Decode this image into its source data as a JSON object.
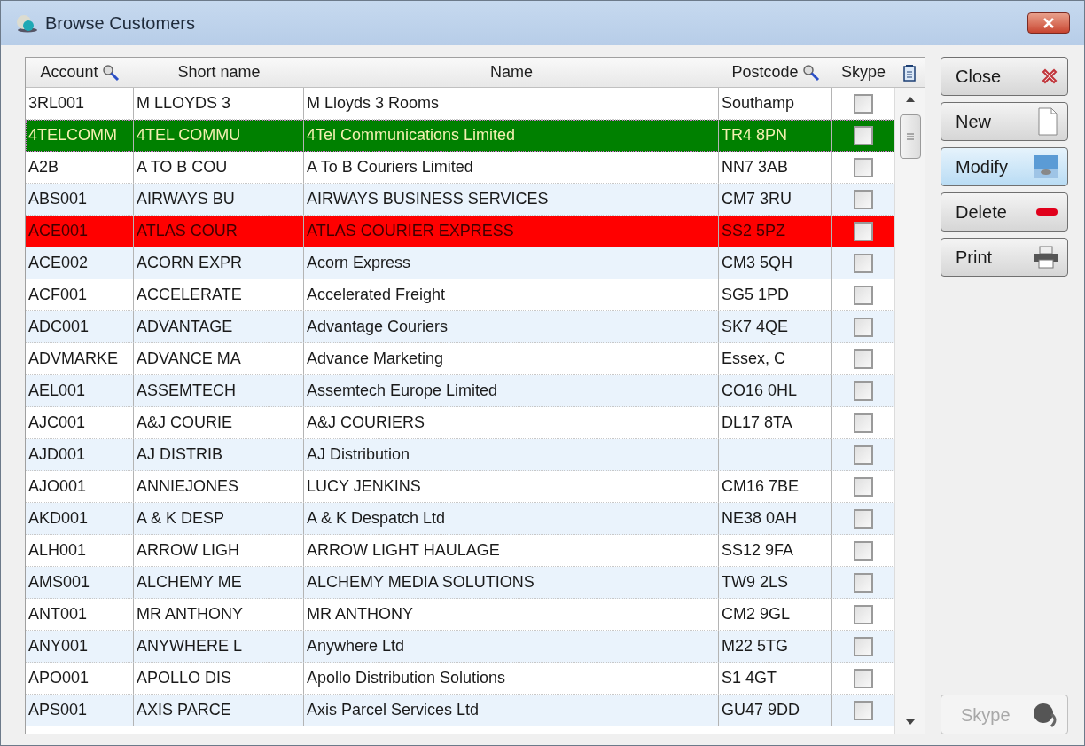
{
  "window": {
    "title": "Browse Customers"
  },
  "table": {
    "columns": [
      {
        "label": "Account",
        "searchable": true
      },
      {
        "label": "Short name",
        "searchable": false
      },
      {
        "label": "Name",
        "searchable": false
      },
      {
        "label": "Postcode",
        "searchable": true
      },
      {
        "label": "Skype",
        "searchable": false
      }
    ],
    "rows": [
      {
        "account": "3RL001",
        "short_name": "M LLOYDS 3",
        "name": "M Lloyds 3 Rooms",
        "postcode": "Southamp",
        "skype": false,
        "selected": false,
        "kind": "normal"
      },
      {
        "account": "4TELCOMM",
        "short_name": "4TEL COMMU",
        "name": "4Tel Communications Limited",
        "postcode": "TR4 8PN",
        "skype": false,
        "selected": true,
        "kind": "normal"
      },
      {
        "account": "A2B",
        "short_name": "A TO B COU",
        "name": "A To B Couriers Limited",
        "postcode": "NN7 3AB",
        "skype": false,
        "selected": false,
        "kind": "normal"
      },
      {
        "account": "ABS001",
        "short_name": "AIRWAYS BU",
        "name": "AIRWAYS BUSINESS SERVICES",
        "postcode": "CM7 3RU",
        "skype": false,
        "selected": false,
        "kind": "normal"
      },
      {
        "account": "ACE001",
        "short_name": "ATLAS COUR",
        "name": "ATLAS COURIER EXPRESS",
        "postcode": "SS2 5PZ",
        "skype": false,
        "selected": false,
        "kind": "alert"
      },
      {
        "account": "ACE002",
        "short_name": "ACORN EXPR",
        "name": "Acorn Express",
        "postcode": "CM3 5QH",
        "skype": false,
        "selected": false,
        "kind": "normal"
      },
      {
        "account": "ACF001",
        "short_name": "ACCELERATE",
        "name": "Accelerated Freight",
        "postcode": "SG5 1PD",
        "skype": false,
        "selected": false,
        "kind": "normal"
      },
      {
        "account": "ADC001",
        "short_name": "ADVANTAGE",
        "name": "Advantage Couriers",
        "postcode": "SK7 4QE",
        "skype": false,
        "selected": false,
        "kind": "normal"
      },
      {
        "account": "ADVMARKE",
        "short_name": "ADVANCE MA",
        "name": "Advance Marketing",
        "postcode": "Essex, C",
        "skype": false,
        "selected": false,
        "kind": "normal"
      },
      {
        "account": "AEL001",
        "short_name": "ASSEMTECH",
        "name": "Assemtech Europe Limited",
        "postcode": "CO16 0HL",
        "skype": false,
        "selected": false,
        "kind": "normal"
      },
      {
        "account": "AJC001",
        "short_name": "A&J COURIE",
        "name": "A&J COURIERS",
        "postcode": "DL17 8TA",
        "skype": false,
        "selected": false,
        "kind": "normal"
      },
      {
        "account": "AJD001",
        "short_name": "AJ DISTRIB",
        "name": "AJ Distribution",
        "skype": false,
        "selected": false,
        "kind": "normal"
      },
      {
        "account": "AJO001",
        "short_name": "ANNIEJONES",
        "name": "LUCY JENKINS",
        "postcode": "CM16 7BE",
        "skype": false,
        "selected": false,
        "kind": "normal"
      },
      {
        "account": "AKD001",
        "short_name": "A & K DESP",
        "name": "A & K Despatch Ltd",
        "postcode": "NE38 0AH",
        "skype": false,
        "selected": false,
        "kind": "normal"
      },
      {
        "account": "ALH001",
        "short_name": "ARROW LIGH",
        "name": "ARROW LIGHT HAULAGE",
        "postcode": "SS12 9FA",
        "skype": false,
        "selected": false,
        "kind": "normal"
      },
      {
        "account": "AMS001",
        "short_name": "ALCHEMY ME",
        "name": "ALCHEMY MEDIA SOLUTIONS",
        "postcode": "TW9 2LS",
        "skype": false,
        "selected": false,
        "kind": "normal"
      },
      {
        "account": "ANT001",
        "short_name": "MR ANTHONY",
        "name": "MR ANTHONY",
        "postcode": "CM2 9GL",
        "skype": false,
        "selected": false,
        "kind": "normal"
      },
      {
        "account": "ANY001",
        "short_name": "ANYWHERE L",
        "name": "Anywhere Ltd",
        "postcode": "M22 5TG",
        "skype": false,
        "selected": false,
        "kind": "normal"
      },
      {
        "account": "APO001",
        "short_name": "APOLLO DIS",
        "name": "Apollo Distribution Solutions",
        "postcode": "S1 4GT",
        "skype": false,
        "selected": false,
        "kind": "normal"
      },
      {
        "account": "APS001",
        "short_name": "AXIS PARCE",
        "name": "Axis Parcel Services Ltd",
        "postcode": "GU47 9DD",
        "skype": false,
        "selected": false,
        "kind": "normal"
      }
    ]
  },
  "buttons": [
    {
      "label": "Close",
      "disabled": false,
      "selected": false
    },
    {
      "label": "New",
      "disabled": false,
      "selected": false
    },
    {
      "label": "Modify",
      "disabled": false,
      "selected": true
    },
    {
      "label": "Delete",
      "disabled": false,
      "selected": false
    },
    {
      "label": "Print",
      "disabled": false,
      "selected": false
    }
  ],
  "skype_button": {
    "label": "Skype",
    "disabled": true
  }
}
